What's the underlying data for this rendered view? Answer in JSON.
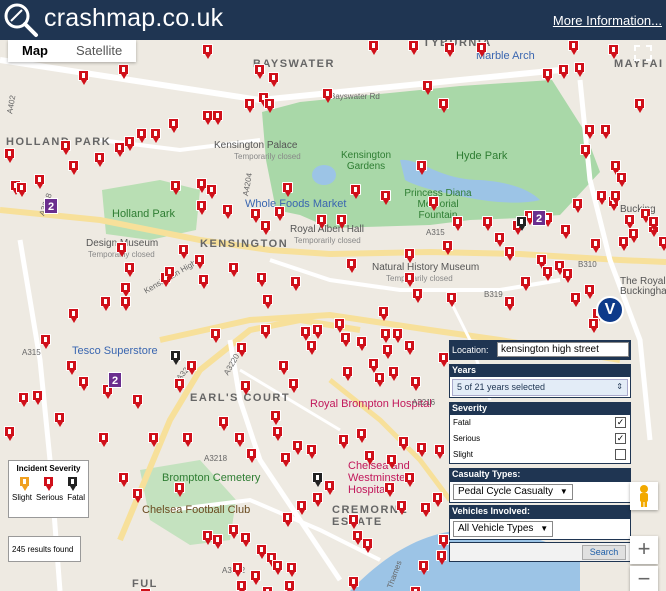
{
  "header": {
    "site_title": "crashmap.co.uk",
    "more_info": "More Information..."
  },
  "map_type": {
    "map": "Map",
    "satellite": "Satellite"
  },
  "places": {
    "bayswater": "BAYSWATER",
    "tyburnia": "TYBURNIA",
    "marble_arch": "Marble Arch",
    "mayfair": "MAYFAI",
    "holland_park_area": "HOLLAND PARK",
    "kensington_palace": "Kensington Palace",
    "kensington_palace_status": "Temporarily closed",
    "kensington_gardens": "Kensington Gardens",
    "hyde_park": "Hyde Park",
    "princess_diana": "Princess Diana Memorial Fountain",
    "holland_park": "Holland Park",
    "whole_foods": "Whole Foods Market",
    "design_museum": "Design Museum",
    "design_museum_status": "Temporarily closed",
    "kensington": "KENSINGTON",
    "royal_albert": "Royal Albert Hall",
    "royal_albert_status": "Temporarily closed",
    "nhm": "Natural History Museum",
    "nhm_status": "Temporarily closed",
    "buckingham": "Bucking",
    "the_royal": "The Royal",
    "buckingham_ham": "Buckingham",
    "tesco": "Tesco Superstore",
    "earls_court": "EARL'S COURT",
    "royal_brompton": "Royal Brompton Hospital",
    "brompton_cemetery": "Brompton Cemetery",
    "chelsea_westminster": "Chelsea and Westminster Hospital",
    "chelsea_fc": "Chelsea Football Club",
    "cremorne": "CREMORNE ESTATE",
    "ful": "FUL",
    "kensington_high_st": "Kensington High St",
    "thames": "Thames"
  },
  "roads": {
    "a402": "A402",
    "bayswater_rd": "Bayswater Rd",
    "a4204": "A4204",
    "a315": "A315",
    "b319": "B319",
    "a3220": "A3220",
    "a3218": "A3218",
    "a3212": "A3212",
    "a3216": "A3216",
    "b310": "B310",
    "b3220": "A3220",
    "a315b": "A315",
    "a3218b": "A3218"
  },
  "legend": {
    "title": "Incident Severity",
    "slight": "Slight",
    "serious": "Serious",
    "fatal": "Fatal"
  },
  "results": "245 results found",
  "panel": {
    "location_label": "Location:",
    "location_value": "kensington high street",
    "years_label": "Years",
    "years_value": "5 of 21 years selected",
    "severity_label": "Severity",
    "fatal": "Fatal",
    "serious": "Serious",
    "slight": "Slight",
    "fatal_checked": true,
    "serious_checked": true,
    "slight_checked": false,
    "casualty_label": "Casualty Types:",
    "casualty_value": "Pedal Cycle Casualty",
    "vehicles_label": "Vehicles Involved:",
    "vehicles_value": "All Vehicle Types",
    "search": "Search"
  },
  "clusters": {
    "c1": "2",
    "c2": "2",
    "c3": "2"
  },
  "v_marker": "V",
  "zoom": {
    "in": "+",
    "out": "−"
  },
  "colors": {
    "header_bg": "#1f3552",
    "slight_marker": "#f0a020",
    "serious_marker": "#d0101a",
    "fatal_marker": "#222222",
    "park": "#a9d8a8",
    "water": "#9cc4e6",
    "cluster": "#6a2e8e"
  }
}
